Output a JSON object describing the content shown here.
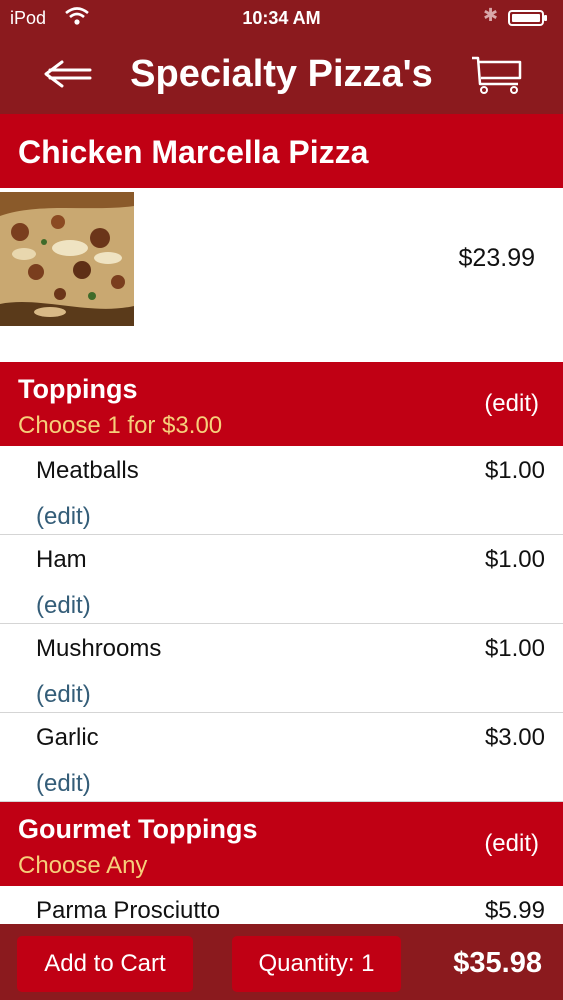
{
  "status_bar": {
    "carrier": "iPod",
    "time": "10:34 AM"
  },
  "nav": {
    "title": "Specialty Pizza's"
  },
  "product": {
    "name": "Chicken Marcella Pizza",
    "price": "$23.99"
  },
  "sections": [
    {
      "title": "Toppings",
      "subtitle": "Choose 1 for $3.00",
      "edit_label": "(edit)",
      "items": [
        {
          "name": "Meatballs",
          "price": "$1.00",
          "edit_label": "(edit)"
        },
        {
          "name": "Ham",
          "price": "$1.00",
          "edit_label": "(edit)"
        },
        {
          "name": "Mushrooms",
          "price": "$1.00",
          "edit_label": "(edit)"
        },
        {
          "name": "Garlic",
          "price": "$3.00",
          "edit_label": "(edit)"
        }
      ]
    },
    {
      "title": "Gourmet Toppings",
      "subtitle": "Choose Any",
      "edit_label": "(edit)",
      "items": [
        {
          "name": "Parma Prosciutto",
          "price": "$5.99"
        }
      ]
    }
  ],
  "bottom": {
    "add_to_cart_label": "Add to Cart",
    "quantity_label": "Quantity: 1",
    "total": "$35.98"
  },
  "icons": {
    "back": "back-arrow-icon",
    "cart": "shopping-cart-icon",
    "wifi": "wifi-icon",
    "bluetooth": "bluetooth-icon",
    "battery": "battery-icon"
  },
  "colors": {
    "header_dark": "#8b1a1e",
    "header_red": "#c00014",
    "subtitle_gold": "#f6cf7b",
    "edit_link": "#345d78"
  }
}
